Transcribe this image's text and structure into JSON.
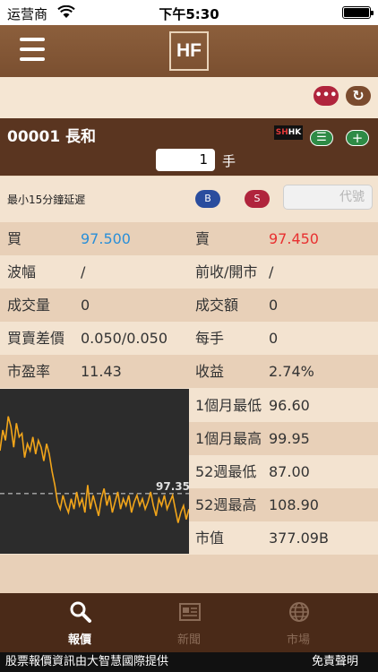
{
  "status_bar": {
    "carrier": "运营商",
    "time": "下午5:30",
    "battery_level": 1.0
  },
  "nav": {
    "logo": "HF"
  },
  "toolbar": {
    "more_label": "•••",
    "refresh_label": "↻"
  },
  "stock": {
    "title": "00001  長和",
    "badge_sh": "SH",
    "badge_hk": "HK",
    "list_button": "☰",
    "add_button": "+",
    "lot_value": "1",
    "lot_unit": "手"
  },
  "delay_row": {
    "delay_text": "最小15分鐘延遲",
    "buy": "B",
    "sell": "S",
    "code_placeholder": "代號"
  },
  "quote_rows": [
    {
      "left_label": "買",
      "left_value": "97.500",
      "right_label": "賣",
      "right_value": "97.450"
    },
    {
      "left_label": "波幅",
      "left_value": "/",
      "right_label": "前收/開市",
      "right_value": "/"
    },
    {
      "left_label": "成交量",
      "left_value": "0",
      "right_label": "成交額",
      "right_value": "0"
    },
    {
      "left_label": "買賣差價",
      "left_value": "0.050/0.050",
      "right_label": "每手",
      "right_value": "0"
    },
    {
      "left_label": "市盈率",
      "left_value": "11.43",
      "right_label": "收益",
      "right_value": "2.74%"
    }
  ],
  "side_rows": [
    {
      "label": "1個月最低",
      "value": "96.60"
    },
    {
      "label": "1個月最高",
      "value": "99.95"
    },
    {
      "label": "52週最低",
      "value": "87.00"
    },
    {
      "label": "52週最高",
      "value": "108.90"
    },
    {
      "label": "市值",
      "value": "377.09B"
    }
  ],
  "chart_data": {
    "type": "line",
    "reference_value": 97.35,
    "reference_label": "97.35",
    "ylim": [
      95.6,
      100.4
    ],
    "values": [
      98.6,
      99.2,
      98.9,
      99.6,
      99.3,
      98.7,
      99.4,
      99.0,
      99.1,
      98.4,
      98.8,
      98.6,
      99.0,
      98.5,
      98.9,
      98.7,
      98.3,
      98.8,
      98.5,
      98.0,
      97.6,
      97.1,
      96.9,
      97.3,
      97.0,
      96.8,
      97.2,
      96.9,
      97.4,
      97.0,
      97.2,
      96.8,
      97.6,
      96.9,
      97.3,
      97.0,
      96.7,
      97.2,
      97.5,
      97.0,
      97.3,
      96.8,
      97.1,
      97.4,
      96.9,
      97.2,
      97.0,
      97.3,
      96.8,
      97.1,
      97.3,
      97.0,
      97.2,
      96.9,
      97.1,
      97.4,
      97.0,
      96.7,
      97.2,
      97.0,
      97.3,
      96.9,
      97.1,
      97.3,
      96.9,
      96.5,
      96.8,
      97.0,
      96.6,
      96.9
    ],
    "series_color": "#f2a51a",
    "reference_color": "#dddddd"
  },
  "tabs": [
    {
      "label": "報價",
      "icon": "search-icon",
      "active": true
    },
    {
      "label": "新聞",
      "icon": "newspaper-icon",
      "active": false
    },
    {
      "label": "市場",
      "icon": "globe-icon",
      "active": false
    }
  ],
  "footer": {
    "source": "股票報價資訊由大智慧國際提供",
    "disclaimer": "免責聲明"
  },
  "colors": {
    "buy_price": "#2a8fd8",
    "sell_price": "#e83030"
  }
}
